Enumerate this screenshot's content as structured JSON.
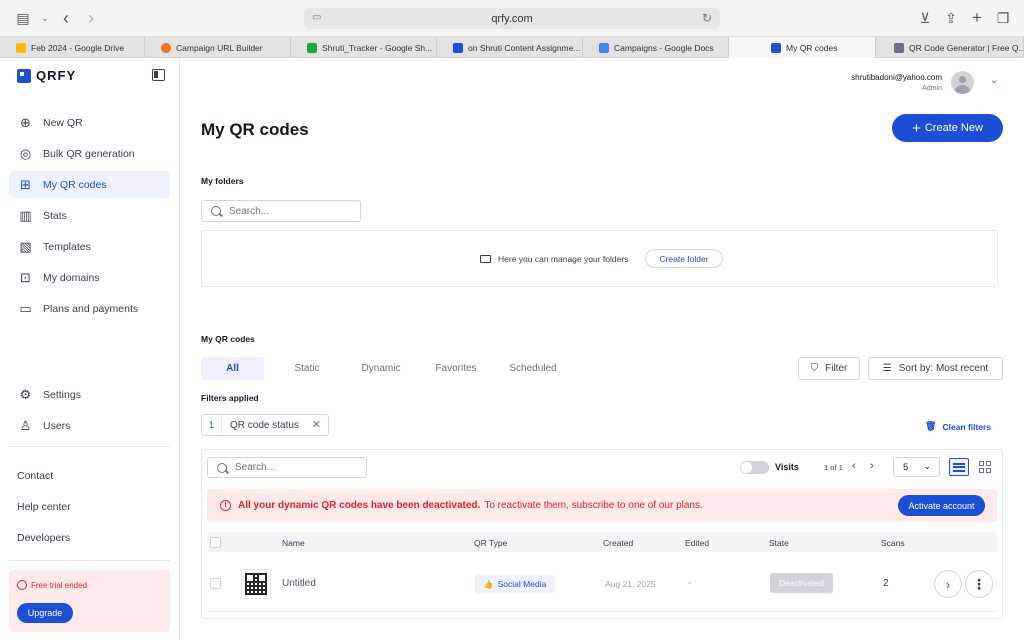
{
  "browser": {
    "url": "qrfy.com",
    "tabs": [
      {
        "label": "Feb 2024 - Google Drive",
        "color": "#fbbc04"
      },
      {
        "label": "Campaign URL Builder",
        "color": "#f97316"
      },
      {
        "label": "Shruti_Tracker - Google Sh...",
        "color": "#16a34a"
      },
      {
        "label": "on Shruti Content Assignme...",
        "color": "#1d4ed8"
      },
      {
        "label": "Campaigns - Google Docs",
        "color": "#4285f4"
      },
      {
        "label": "My QR codes",
        "color": "#1d4ed8"
      },
      {
        "label": "QR Code Generator | Free Q...",
        "color": "#6b7280"
      }
    ]
  },
  "brand": {
    "name": "QRFY",
    "accent": "#1d4ed8"
  },
  "sidebar": {
    "nav": [
      {
        "label": "New QR",
        "icon": "plus-circle-icon"
      },
      {
        "label": "Bulk QR generation",
        "icon": "target-icon"
      },
      {
        "label": "My QR codes",
        "icon": "qr-icon"
      },
      {
        "label": "Stats",
        "icon": "bar-chart-icon"
      },
      {
        "label": "Templates",
        "icon": "template-icon"
      },
      {
        "label": "My domains",
        "icon": "domain-icon"
      },
      {
        "label": "Plans and payments",
        "icon": "card-icon"
      }
    ],
    "settings": {
      "label": "Settings",
      "icon": "gear-icon"
    },
    "users": {
      "label": "Users",
      "icon": "user-icon"
    },
    "links": [
      "Contact",
      "Help center",
      "Developers"
    ],
    "trial": {
      "message": "Free trial ended",
      "button": "Upgrade"
    }
  },
  "user": {
    "email": "shrutibadoni@yahoo.com",
    "role": "Admin"
  },
  "main": {
    "title": "My QR codes",
    "create_new": "Create New",
    "folders": {
      "label": "My folders",
      "search_placeholder": "Search...",
      "hint": "Here you can manage your folders",
      "create_folder": "Create folder"
    },
    "qr_section": {
      "label": "My QR codes",
      "tabs": [
        "All",
        "Static",
        "Dynamic",
        "Favorites",
        "Scheduled"
      ],
      "filter": "Filter",
      "sort": "Sort by: Most recent",
      "filters_applied": "Filters applied",
      "chip": {
        "count": "1",
        "label": "QR code status"
      },
      "clean_filters": "Clean filters"
    },
    "list": {
      "search_placeholder": "Search...",
      "visits": "Visits",
      "pager": "1 of 1",
      "per_page": "5",
      "alert_bold": "All your dynamic QR codes have been deactivated.",
      "alert_text": "To reactivate them, subscribe to one of our plans.",
      "activate": "Activate account",
      "columns": [
        "Name",
        "QR Type",
        "Created",
        "Edited",
        "State",
        "Scans"
      ],
      "rows": [
        {
          "name": "Untitled",
          "type": "Social Media",
          "created": "Aug 21, 2025",
          "edited": "-",
          "state": "Deactivated",
          "scans": "2"
        }
      ]
    }
  }
}
